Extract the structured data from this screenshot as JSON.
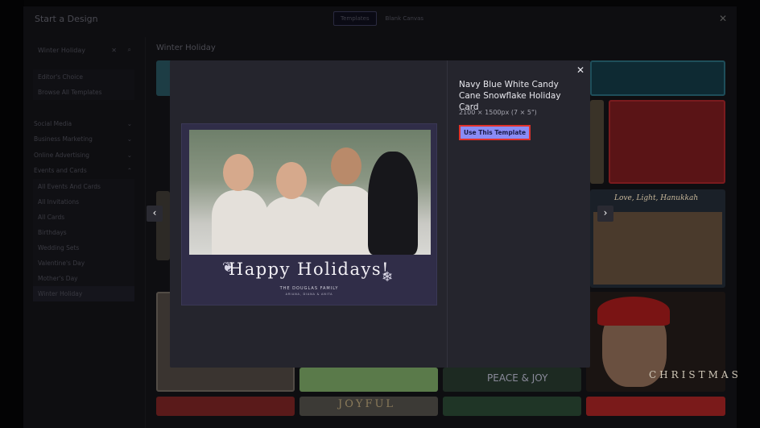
{
  "dialog": {
    "title": "Start a Design",
    "tabs": [
      {
        "label": "Templates",
        "active": true
      },
      {
        "label": "Blank Canvas",
        "active": false
      }
    ]
  },
  "sidebar": {
    "search_value": "Winter Holiday",
    "top_items": [
      "Editor's Choice",
      "Browse All Templates"
    ],
    "categories": [
      {
        "label": "Social Media",
        "expanded": false
      },
      {
        "label": "Business Marketing",
        "expanded": false
      },
      {
        "label": "Online Advertising",
        "expanded": false
      },
      {
        "label": "Events and Cards",
        "expanded": true
      }
    ],
    "sub_items": [
      "All Events And Cards",
      "All Invitations",
      "All Cards",
      "Birthdays",
      "Wedding Sets",
      "Valentine's Day",
      "Mother's Day",
      "Winter Holiday"
    ],
    "selected": "Winter Holiday"
  },
  "main": {
    "title": "Winter Holiday",
    "thumb_texts": [
      "Love, Light, Hanukkah",
      "CHRISTMAS",
      "JOYFUL",
      "PEACE & JOY"
    ]
  },
  "preview": {
    "title": "Navy Blue White Candy Cane Snowflake Holiday Card",
    "dimensions": "2100 × 1500px (7 × 5\")",
    "use_button": "Use This Template",
    "card": {
      "greeting": "Happy Holidays!",
      "family": "THE DOUGLAS FAMILY",
      "names": "ARIANA, DIANA & ANITA"
    }
  },
  "colors": {
    "accent": "#8a8cf5",
    "highlight": "#e0322b",
    "modal_bg": "#25252d",
    "card_bg": "#302d48"
  }
}
